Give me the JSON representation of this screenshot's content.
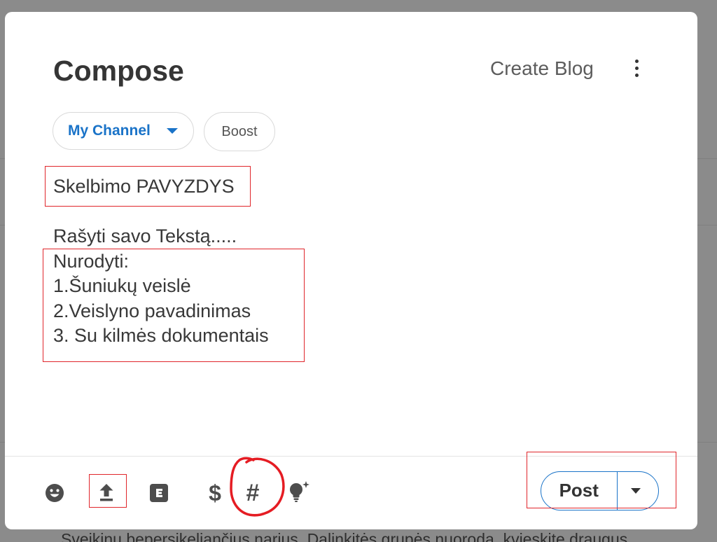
{
  "compose": {
    "title": "Compose",
    "create_blog_label": "Create Blog",
    "more_icon": "more-vertical-icon",
    "channel": {
      "selected": "My Channel",
      "icon": "caret-down-icon"
    },
    "boost_label": "Boost",
    "editor": {
      "heading": "Skelbimo PAVYZDYS",
      "lines": [
        "Rašyti savo Tekstą.....",
        "Nurodyti:",
        "1.Šuniukų veislė",
        "2.Veislyno pavadinimas",
        "3. Su kilmės dokumentais"
      ]
    },
    "toolbar": {
      "emoji_icon": "smiley-icon",
      "upload_icon": "upload-icon",
      "embed_icon": "embed-e-icon",
      "tip_glyph": "$",
      "hashtag_glyph": "#",
      "ideas_icon": "lightbulb-sparkle-icon"
    },
    "post": {
      "label": "Post",
      "menu_icon": "caret-down-icon"
    }
  },
  "background": {
    "text": "Sveikinu bepersikeliančius narius. Dalinkitės grupės nuoroda, kvieskite draugus"
  },
  "colors": {
    "overlay": "#8b8b8b",
    "accent": "#1a73c8",
    "annotation_red": "#e0262b",
    "icon": "#4d4d4d",
    "text": "#383838"
  }
}
